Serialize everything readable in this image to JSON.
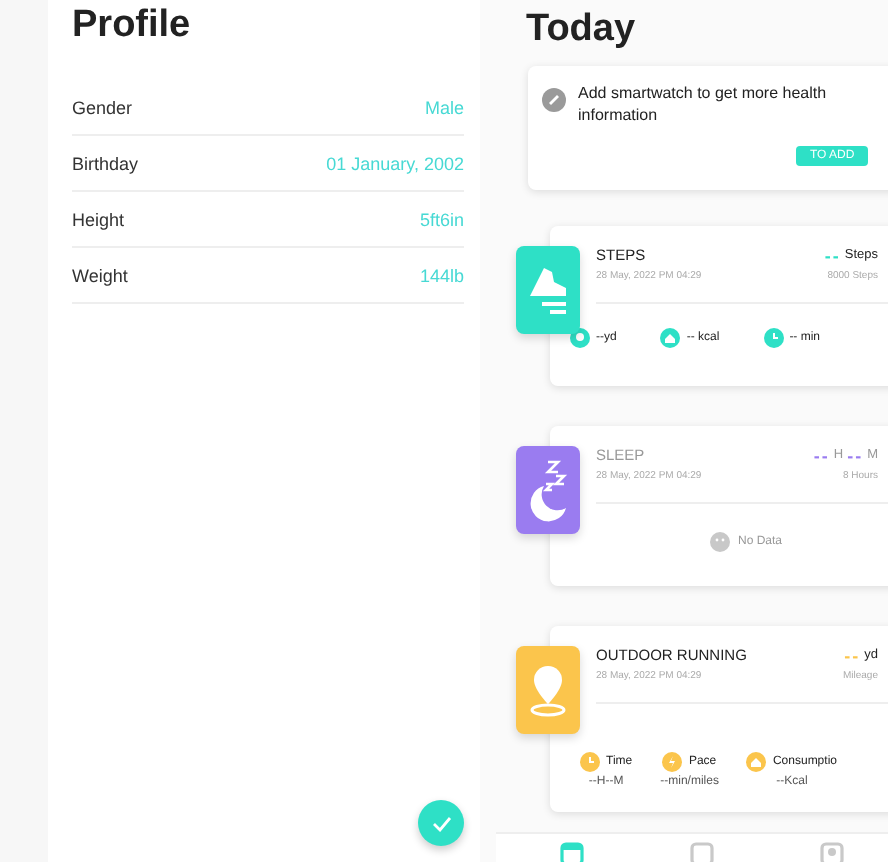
{
  "profile": {
    "title": "Profile",
    "rows": [
      {
        "label": "Gender",
        "value": "Male"
      },
      {
        "label": "Birthday",
        "value": "01 January, 2002"
      },
      {
        "label": "Height",
        "value": "5ft6in"
      },
      {
        "label": "Weight",
        "value": "144lb"
      }
    ]
  },
  "today": {
    "title": "Today",
    "prompt": {
      "text": "Add smartwatch to get more health information",
      "button": "TO ADD"
    },
    "activities": [
      {
        "kind": "steps",
        "name": "STEPS",
        "time": "28 May, 2022 PM 04:29",
        "color": "#2ee0c6",
        "reading": [
          {
            "dash": "--",
            "unit": "Steps"
          }
        ],
        "target": "8000 Steps",
        "footer": {
          "kind": "inline",
          "metrics": [
            {
              "text": "--yd"
            },
            {
              "text": "-- kcal"
            },
            {
              "text": "-- min"
            }
          ]
        }
      },
      {
        "kind": "sleep",
        "name": "SLEEP",
        "time": "28 May, 2022 PM 04:29",
        "color": "#9a7cf0",
        "reading": [
          {
            "dash": "--",
            "unit": "H"
          },
          {
            "dash": "--",
            "unit": "M"
          }
        ],
        "target": "8 Hours",
        "footer": {
          "kind": "no_data",
          "text": "No Data"
        }
      },
      {
        "kind": "running",
        "name": "OUTDOOR RUNNING",
        "time": "28 May, 2022 PM 04:29",
        "color": "#fbc54c",
        "reading": [
          {
            "dash": "--",
            "unit": "yd"
          }
        ],
        "target": "Mileage",
        "footer": {
          "kind": "stacked",
          "metrics": [
            {
              "label": "Time",
              "value": "--H--M"
            },
            {
              "label": "Pace",
              "value": "--min/miles"
            },
            {
              "label": "Consumptio",
              "value": "--Kcal"
            }
          ]
        }
      }
    ],
    "nav": [
      {
        "selected": true
      },
      {
        "selected": false
      },
      {
        "selected": false
      }
    ]
  }
}
